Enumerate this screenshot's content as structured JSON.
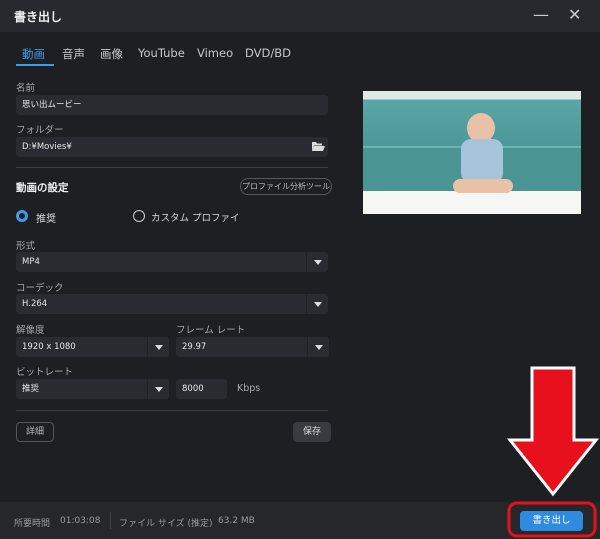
{
  "window": {
    "title": "書き出し",
    "minimize": "—",
    "close": "✕"
  },
  "tabs": [
    "動画",
    "音声",
    "画像",
    "YouTube",
    "Vimeo",
    "DVD/BD"
  ],
  "name": {
    "label": "名前",
    "value": "思い出ムービー"
  },
  "folder": {
    "label": "フォルダー",
    "value": "D:¥Movies¥",
    "icon": "folder-open-icon"
  },
  "settings": {
    "title": "動画の設定",
    "profile_tool": "プロファイル分析ツール",
    "radio_recommended": "推奨",
    "radio_custom": "カスタム プロファイ",
    "selected": "推奨"
  },
  "format": {
    "label": "形式",
    "value": "MP4"
  },
  "codec": {
    "label": "コーデック",
    "value": "H.264"
  },
  "resolution": {
    "label": "解像度",
    "value": "1920 x 1080"
  },
  "framerate": {
    "label": "フレーム レート",
    "value": "29.97"
  },
  "bitrate": {
    "label": "ビットレート",
    "value": "推奨",
    "kbps_value": "8000",
    "unit": "Kbps"
  },
  "buttons": {
    "details": "詳細",
    "save": "保存",
    "export": "書き出し"
  },
  "footer": {
    "time_label": "所要時間",
    "time_value": "01:03:08",
    "size_label": "ファイル サイズ (推定)",
    "size_value": "63.2 MB"
  },
  "colors": {
    "accent": "#3d9be9",
    "annotation": "#e8101c"
  }
}
